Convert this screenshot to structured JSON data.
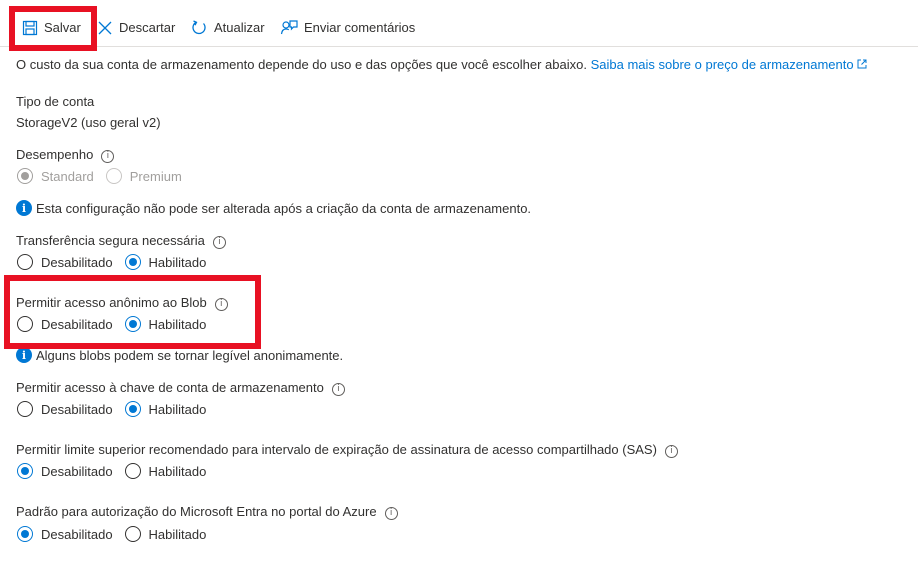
{
  "toolbar": {
    "save_label": "Salvar",
    "discard_label": "Descartar",
    "refresh_label": "Atualizar",
    "feedback_label": "Enviar comentários"
  },
  "intro": {
    "text": "O custo da sua conta de armazenamento depende do uso e das opções que você escolher abaixo.",
    "link_text": "Saiba mais sobre o preço de armazenamento"
  },
  "account_type": {
    "label": "Tipo de conta",
    "value": "StorageV2 (uso geral v2)"
  },
  "performance": {
    "label": "Desempenho",
    "options": [
      "Standard",
      "Premium"
    ],
    "selected": "Standard",
    "note": "Esta configuração não pode ser alterada após a criação da conta de armazenamento."
  },
  "secure_transfer": {
    "label": "Transferência segura necessária",
    "options": [
      "Desabilitado",
      "Habilitado"
    ],
    "selected": "Habilitado"
  },
  "anonymous_blob": {
    "label": "Permitir acesso anônimo ao Blob",
    "options": [
      "Desabilitado",
      "Habilitado"
    ],
    "selected": "Habilitado",
    "note": "Alguns blobs podem se tornar legível anonimamente."
  },
  "key_access": {
    "label": "Permitir acesso à chave de conta de armazenamento",
    "options": [
      "Desabilitado",
      "Habilitado"
    ],
    "selected": "Habilitado"
  },
  "sas_limit": {
    "label": "Permitir limite superior recomendado para intervalo de expiração de assinatura de acesso compartilhado (SAS)",
    "options": [
      "Desabilitado",
      "Habilitado"
    ],
    "selected": "Desabilitado"
  },
  "entra_default": {
    "label": "Padrão para autorização do Microsoft Entra no portal do Azure",
    "options": [
      "Desabilitado",
      "Habilitado"
    ],
    "selected": "Desabilitado"
  },
  "colors": {
    "accent": "#0078d4",
    "highlight": "#e81123",
    "text": "#323130",
    "disabled": "#a19f9d"
  },
  "icons": [
    "save-icon",
    "close-icon",
    "refresh-icon",
    "feedback-icon",
    "info-icon",
    "external-link-icon"
  ]
}
